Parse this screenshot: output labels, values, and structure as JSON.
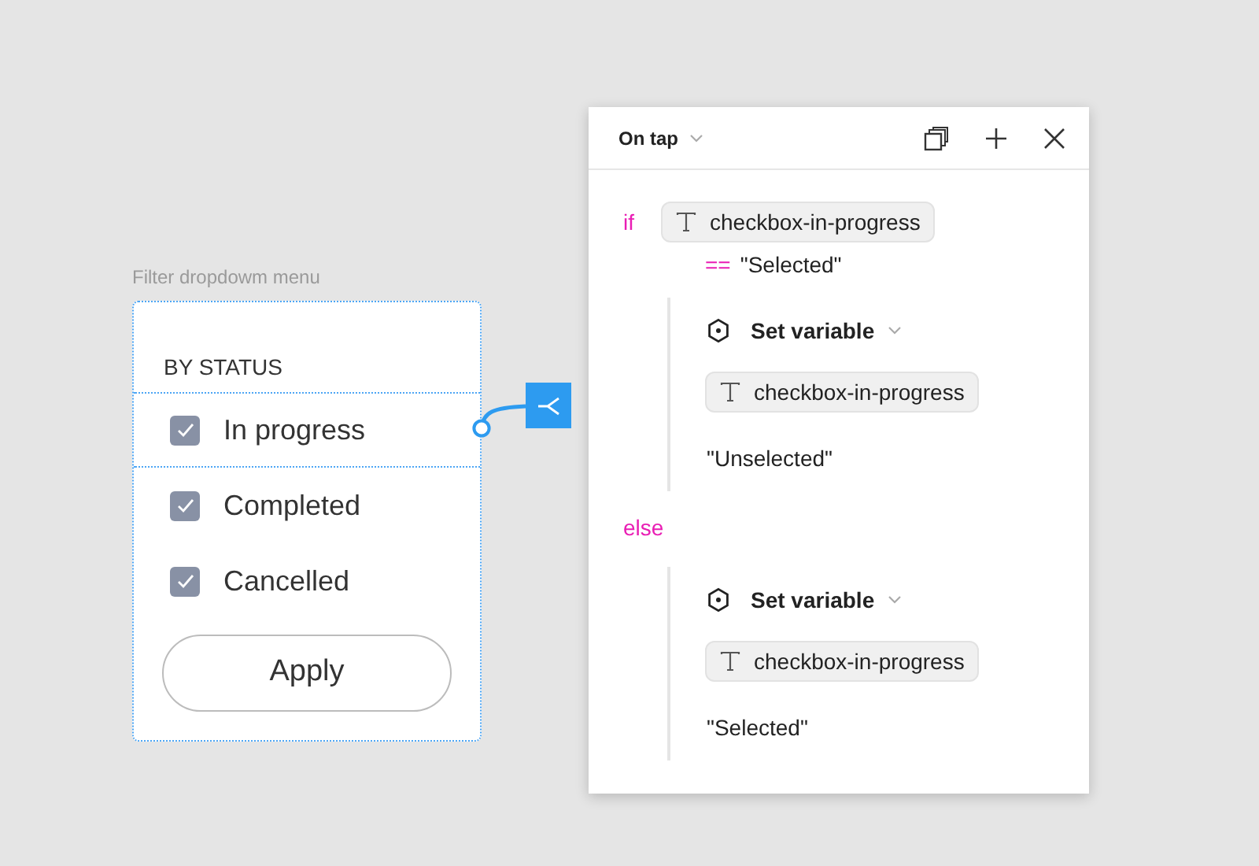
{
  "frame": {
    "label": "Filter dropdowm menu",
    "heading": "BY STATUS",
    "options": [
      {
        "label": "In progress",
        "checked": true,
        "selected": true
      },
      {
        "label": "Completed",
        "checked": true,
        "selected": false
      },
      {
        "label": "Cancelled",
        "checked": true,
        "selected": false
      }
    ],
    "button": "Apply"
  },
  "panel": {
    "trigger": "On tap",
    "branches": [
      {
        "keyword": "if",
        "condition": {
          "variable": "checkbox-in-progress",
          "operator": "==",
          "value": "\"Selected\""
        },
        "actions": [
          {
            "title": "Set variable",
            "variable": "checkbox-in-progress",
            "value": "\"Unselected\""
          }
        ]
      },
      {
        "keyword": "else",
        "actions": [
          {
            "title": "Set variable",
            "variable": "checkbox-in-progress",
            "value": "\"Selected\""
          }
        ]
      }
    ]
  }
}
